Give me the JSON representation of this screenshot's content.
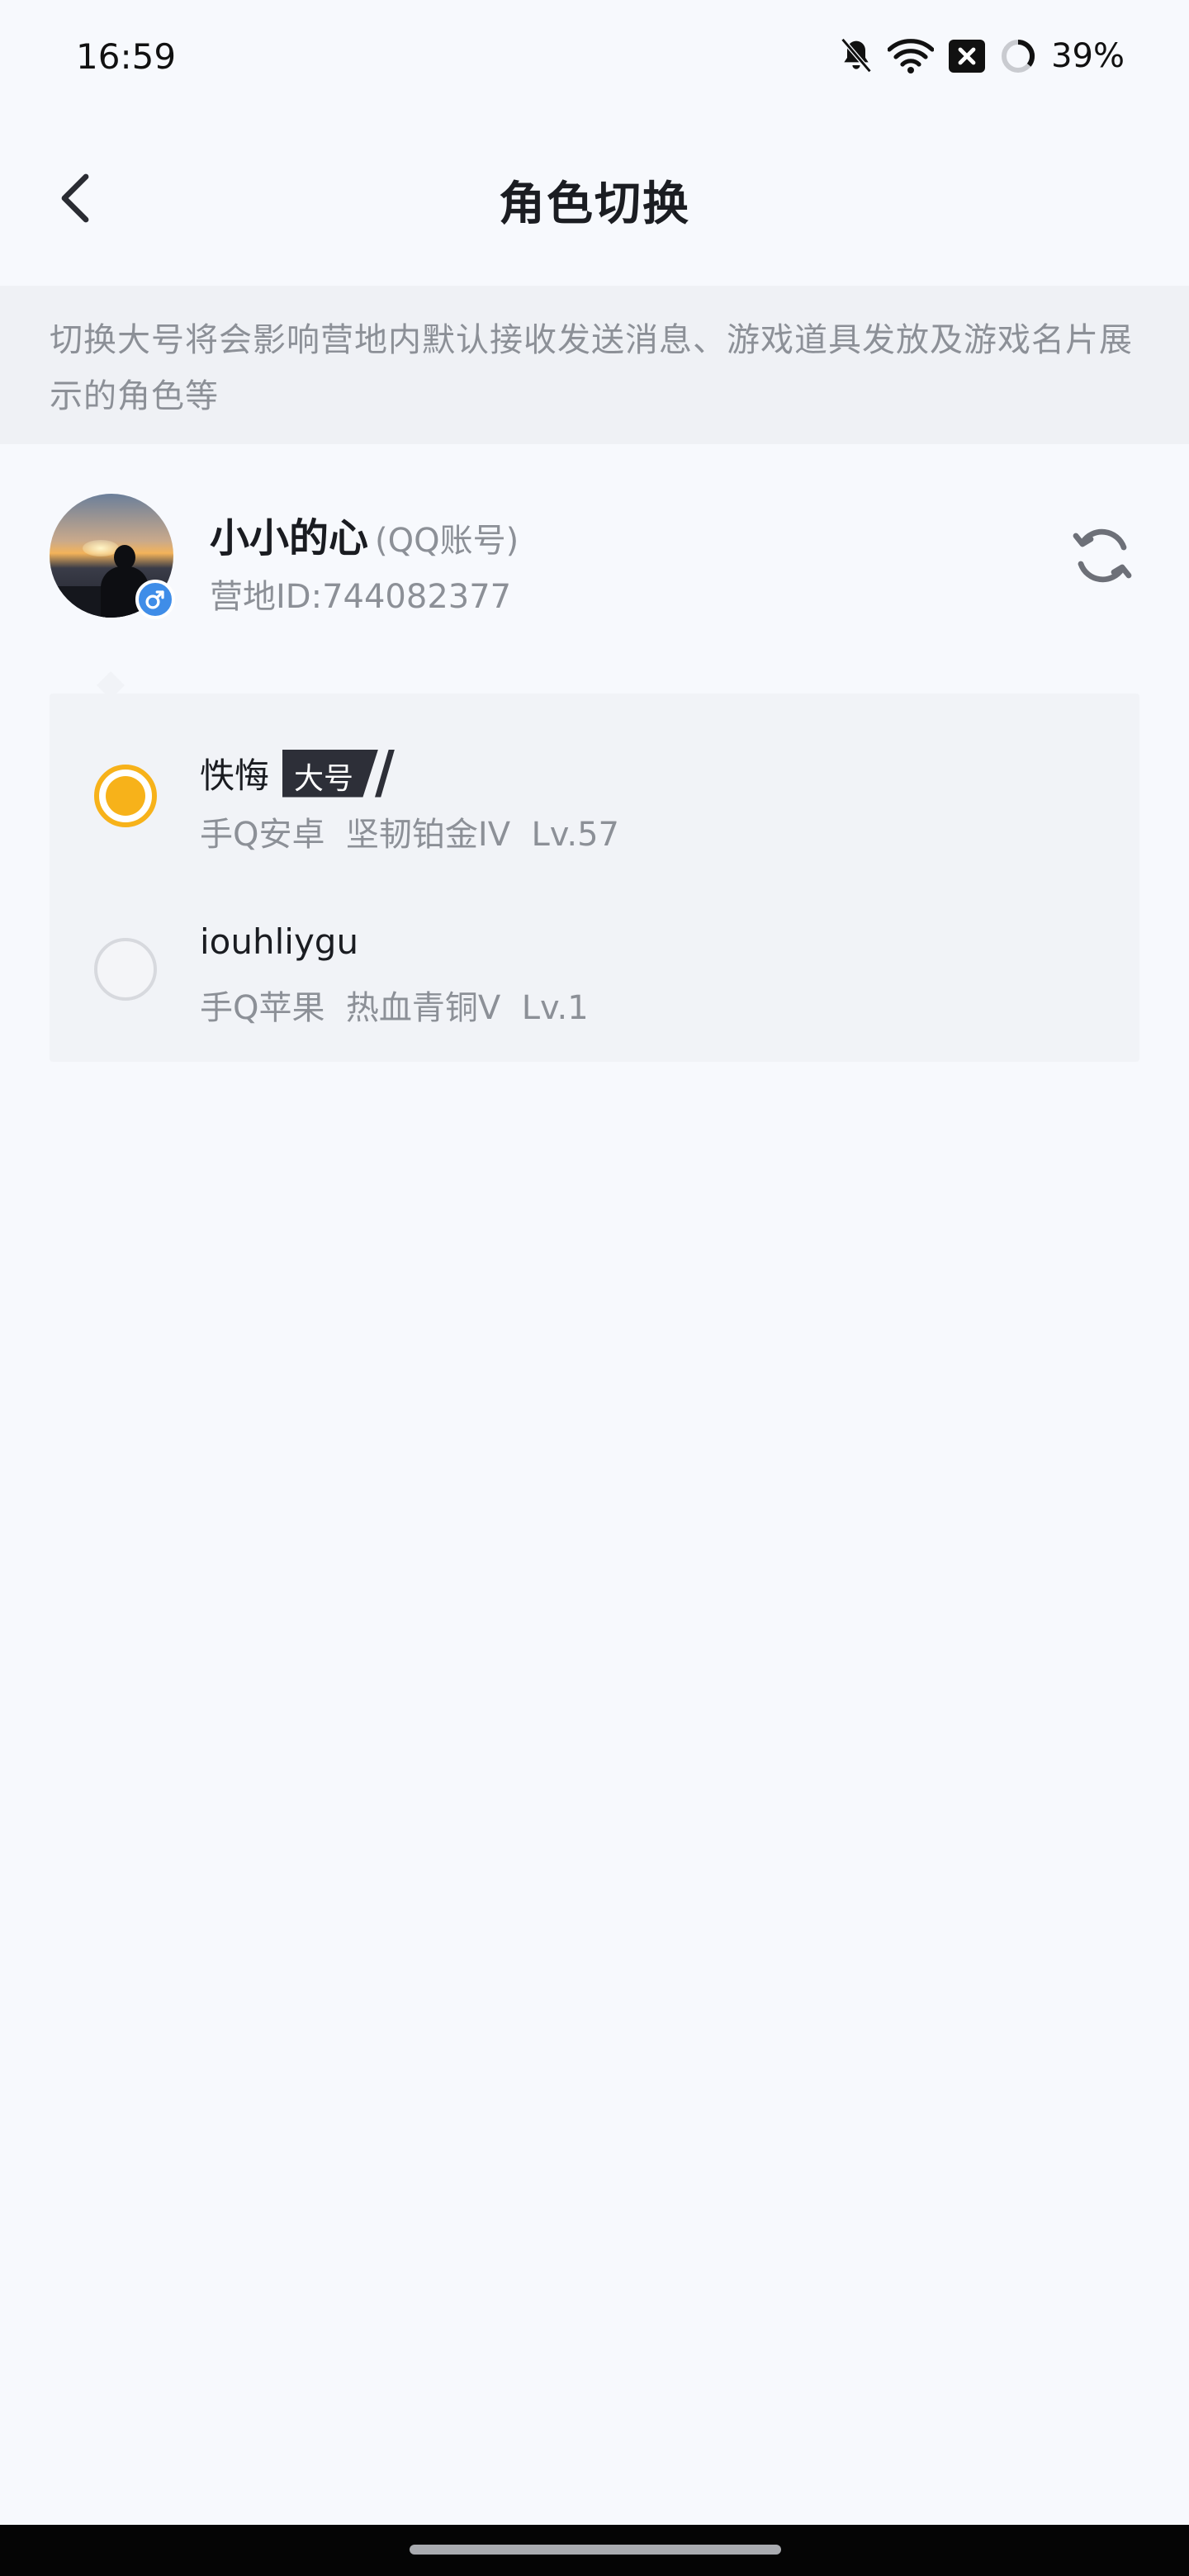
{
  "status_bar": {
    "time": "16:59",
    "battery": "39%",
    "icons": [
      "bell-off-icon",
      "wifi-icon",
      "sim-off-icon",
      "battery-ring-icon"
    ]
  },
  "header": {
    "title": "角色切换",
    "back_icon": "chevron-left-icon"
  },
  "notice": {
    "text": "切换大号将会影响营地内默认接收发送消息、游戏道具发放及游戏名片展示的角色等"
  },
  "account": {
    "name": "小小的心",
    "type": "(QQ账号)",
    "id_text": "营地ID:744082377",
    "gender_icon": "male-icon",
    "refresh_icon": "refresh-icon"
  },
  "roles": [
    {
      "name": "怢悔",
      "badge": "大号",
      "meta": "手Q安卓  坚韧铂金IV  Lv.57",
      "selected": true
    },
    {
      "name": "iouhliygu",
      "badge": "",
      "meta": "手Q苹果  热血青铜V  Lv.1",
      "selected": false
    }
  ],
  "colors": {
    "accent": "#f7b21a",
    "background": "#f7f9fd",
    "panel": "#f1f3f7",
    "muted_text": "#8c9097",
    "badge_bg": "#2d2f38",
    "gender_badge": "#3f8de8"
  }
}
